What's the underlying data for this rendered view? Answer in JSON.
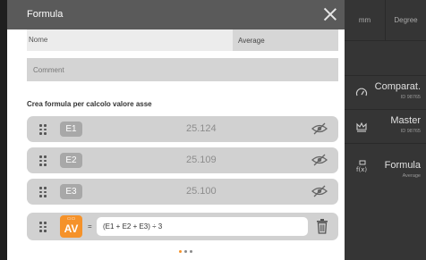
{
  "background_app": {
    "units": "mm",
    "angle_unit": "Degree",
    "items": [
      {
        "title": "Comparat.",
        "sub": "ID 98765",
        "icon": "gauge-icon"
      },
      {
        "title": "Master",
        "sub": "ID 98765",
        "icon": "crown-icon"
      },
      {
        "title": "Formula",
        "sub": "Average",
        "icon": "formula-icon"
      }
    ]
  },
  "dialog": {
    "title": "Formula",
    "name_label": "Nome",
    "name_value": "Average",
    "comment_placeholder": "Comment",
    "section_title": "Crea formula per calcolo valore asse",
    "rows": [
      {
        "chip": "E1",
        "value": "25.124"
      },
      {
        "chip": "E2",
        "value": "25.109"
      },
      {
        "chip": "E3",
        "value": "25.100"
      }
    ],
    "result": {
      "chip": "AV",
      "equals": "=",
      "formula": "(E1 + E2 + E3) ÷ 3"
    },
    "pagination": {
      "pages": 3,
      "current": 1
    }
  },
  "colors": {
    "accent": "#f5922a",
    "titlebar": "#5a5a5a",
    "row_bg": "#d1d1d1",
    "chip_gray": "#a8a8a8"
  }
}
